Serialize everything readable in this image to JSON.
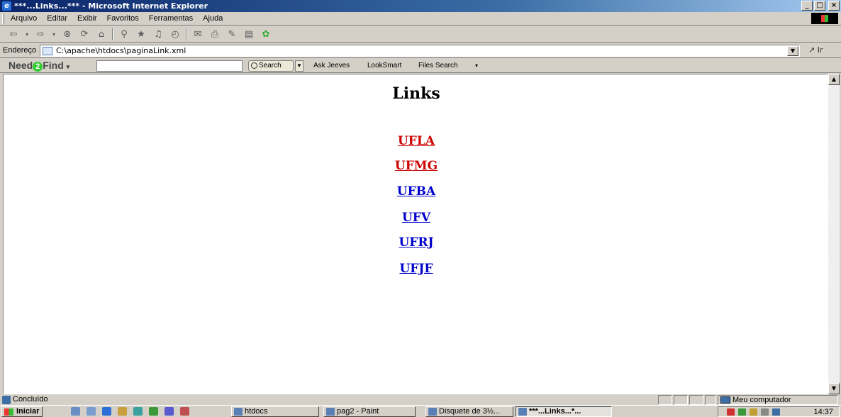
{
  "window": {
    "title": "***...Links...*** - Microsoft Internet Explorer",
    "controls": [
      "_",
      "□",
      "×"
    ]
  },
  "menu": [
    "Arquivo",
    "Editar",
    "Exibir",
    "Favoritos",
    "Ferramentas",
    "Ajuda"
  ],
  "toolbar_icons": [
    "back-icon",
    "forward-icon",
    "stop-icon",
    "refresh-icon",
    "home-icon",
    "search-icon",
    "favorites-icon",
    "media-icon",
    "history-icon",
    "mail-icon",
    "print-icon",
    "edit-icon",
    "discuss-icon",
    "messenger-icon"
  ],
  "address": {
    "label": "Endereço",
    "value": "C:\\apache\\htdocs\\paginaLink.xml",
    "go_label": "Ir"
  },
  "findbar": {
    "brand_prefix": "Need",
    "brand_number": "2",
    "brand_suffix": "Find",
    "search_label": "Search",
    "links": [
      "Ask Jeeves",
      "LookSmart",
      "Files Search"
    ]
  },
  "page": {
    "heading": "Links",
    "links": [
      {
        "label": "UFLA",
        "state": "visited"
      },
      {
        "label": "UFMG",
        "state": "visited"
      },
      {
        "label": "UFBA",
        "state": "unvisited"
      },
      {
        "label": "UFV",
        "state": "unvisited"
      },
      {
        "label": "UFRJ",
        "state": "unvisited"
      },
      {
        "label": "UFJF",
        "state": "unvisited"
      }
    ]
  },
  "status": {
    "text": "Concluído",
    "zone": "Meu computador"
  },
  "taskbar": {
    "start_label": "Iniciar",
    "tasks": [
      {
        "label": "htdocs",
        "active": false
      },
      {
        "label": "pag2 - Paint",
        "active": false
      },
      {
        "label": "Disquete de 3½...",
        "active": false
      },
      {
        "label": "***...Links...*...",
        "active": true
      }
    ],
    "clock": "14:37"
  },
  "colors": {
    "visited_link": "#cc0000",
    "unvisited_link": "#0000cc",
    "titlebar_start": "#0a246a",
    "titlebar_end": "#a6caf0",
    "chrome": "#d4d0c8"
  }
}
